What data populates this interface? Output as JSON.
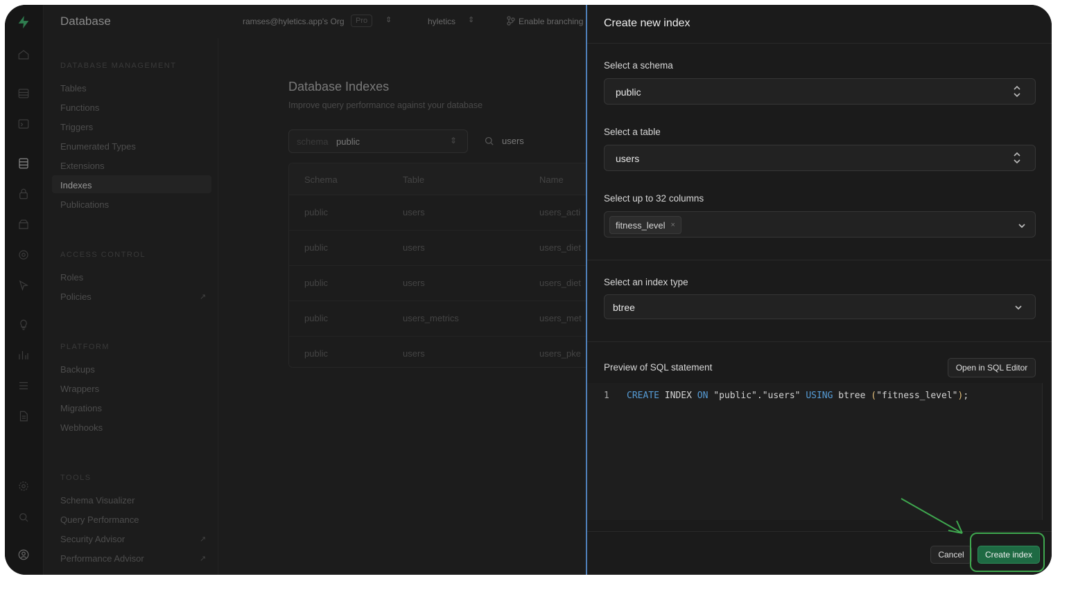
{
  "topbar": {
    "section_title": "Database",
    "org": "ramses@hyletics.app's Org",
    "plan": "Pro",
    "project": "hyletics",
    "branching": "Enable branching"
  },
  "sidebar": {
    "sections": [
      {
        "title": "DATABASE MANAGEMENT",
        "items": [
          "Tables",
          "Functions",
          "Triggers",
          "Enumerated Types",
          "Extensions",
          "Indexes",
          "Publications"
        ]
      },
      {
        "title": "ACCESS CONTROL",
        "items": [
          "Roles",
          "Policies"
        ]
      },
      {
        "title": "PLATFORM",
        "items": [
          "Backups",
          "Wrappers",
          "Migrations",
          "Webhooks"
        ]
      },
      {
        "title": "TOOLS",
        "items": [
          "Schema Visualizer",
          "Query Performance",
          "Security Advisor",
          "Performance Advisor"
        ]
      }
    ],
    "active_item": "Indexes",
    "external_link_glyph": "↗"
  },
  "main": {
    "title": "Database Indexes",
    "subtitle": "Improve query performance against your database",
    "schema_filter_label": "schema",
    "schema_filter_value": "public",
    "search_value": "users",
    "columns": [
      "Schema",
      "Table",
      "Name"
    ],
    "rows": [
      [
        "public",
        "users",
        "users_acti"
      ],
      [
        "public",
        "users",
        "users_diet"
      ],
      [
        "public",
        "users",
        "users_diet"
      ],
      [
        "public",
        "users_metrics",
        "users_met"
      ],
      [
        "public",
        "users",
        "users_pke"
      ]
    ]
  },
  "panel": {
    "title": "Create new index",
    "schema_label": "Select a schema",
    "schema_value": "public",
    "table_label": "Select a table",
    "table_value": "users",
    "columns_label": "Select up to 32 columns",
    "selected_column": "fitness_level",
    "remove_glyph": "×",
    "index_type_label": "Select an index type",
    "index_type_value": "btree",
    "preview_label": "Preview of SQL statement",
    "open_sql_editor": "Open in SQL Editor",
    "sql_line_number": "1",
    "sql": {
      "kw_create": "CREATE",
      "index": " INDEX ",
      "kw_on": "ON",
      "target": " \"public\".\"users\" ",
      "kw_using": "USING",
      "method": " btree ",
      "open_paren": "(",
      "column": "\"fitness_level\"",
      "close_paren": ")",
      "end": ";"
    },
    "cancel": "Cancel",
    "create": "Create index"
  },
  "colors": {
    "accent_green": "#1e6a43",
    "panel_border": "#4f7fb8",
    "annotation": "#3fa84f"
  }
}
